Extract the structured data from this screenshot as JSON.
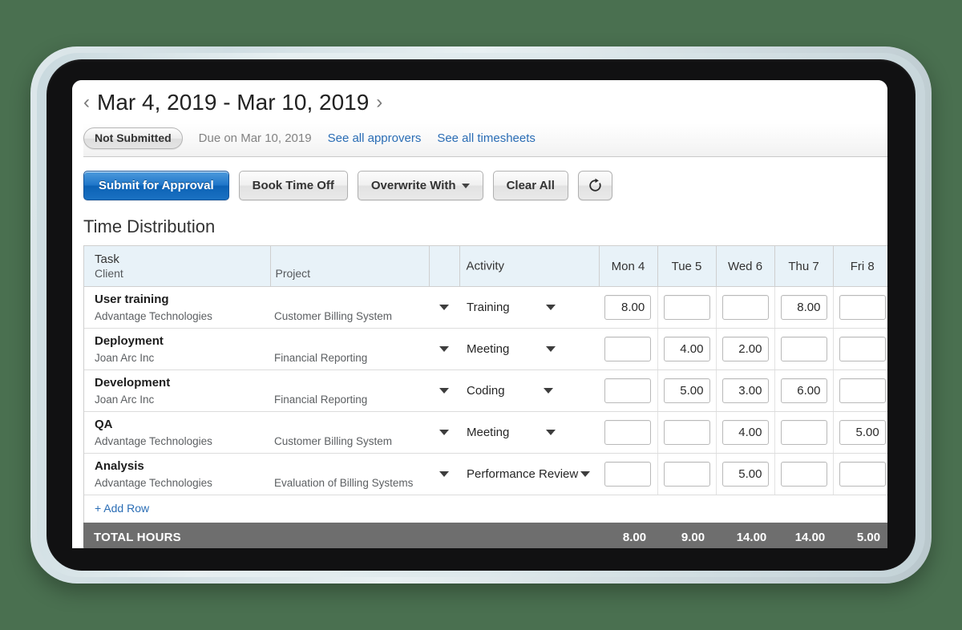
{
  "header": {
    "prev_icon": "chevron-left-icon",
    "next_icon": "chevron-right-icon",
    "date_range": "Mar 4, 2019 - Mar 10, 2019",
    "status_badge": "Not Submitted",
    "due_text": "Due on Mar 10, 2019",
    "link_approvers": "See all approvers",
    "link_timesheets": "See all timesheets"
  },
  "toolbar": {
    "submit_label": "Submit for Approval",
    "book_time_off_label": "Book Time Off",
    "overwrite_label": "Overwrite With",
    "clear_all_label": "Clear All",
    "refresh_icon": "refresh-icon"
  },
  "section": {
    "title": "Time Distribution"
  },
  "table": {
    "headers": {
      "task": "Task",
      "client": "Client",
      "project": "Project",
      "activity": "Activity"
    },
    "days": [
      "Mon 4",
      "Tue 5",
      "Wed 6",
      "Thu 7",
      "Fri 8"
    ],
    "rows": [
      {
        "task": "User training",
        "client": "Advantage Technologies",
        "project": "Customer Billing System",
        "activity": "Training",
        "hours": [
          "8.00",
          "",
          "",
          "8.00",
          ""
        ]
      },
      {
        "task": "Deployment",
        "client": "Joan Arc Inc",
        "project": "Financial Reporting",
        "activity": "Meeting",
        "hours": [
          "",
          "4.00",
          "2.00",
          "",
          ""
        ]
      },
      {
        "task": "Development",
        "client": "Joan Arc Inc",
        "project": "Financial Reporting",
        "activity": "Coding",
        "hours": [
          "",
          "5.00",
          "3.00",
          "6.00",
          ""
        ]
      },
      {
        "task": "QA",
        "client": "Advantage Technologies",
        "project": "Customer Billing System",
        "activity": "Meeting",
        "hours": [
          "",
          "",
          "4.00",
          "",
          "5.00"
        ]
      },
      {
        "task": "Analysis",
        "client": "Advantage Technologies",
        "project": "Evaluation of Billing Systems",
        "activity": "Performance Review",
        "hours": [
          "",
          "",
          "5.00",
          "",
          ""
        ]
      }
    ],
    "add_row_label": "+ Add Row",
    "totals_label": "TOTAL HOURS",
    "totals": [
      "8.00",
      "9.00",
      "14.00",
      "14.00",
      "5.00"
    ]
  },
  "colors": {
    "page_background": "#4a7050",
    "primary_button": "#1f76c9",
    "link": "#2a6db5",
    "table_header_bg": "#e8f2f8",
    "totals_bar_bg": "#6e6e6e"
  }
}
